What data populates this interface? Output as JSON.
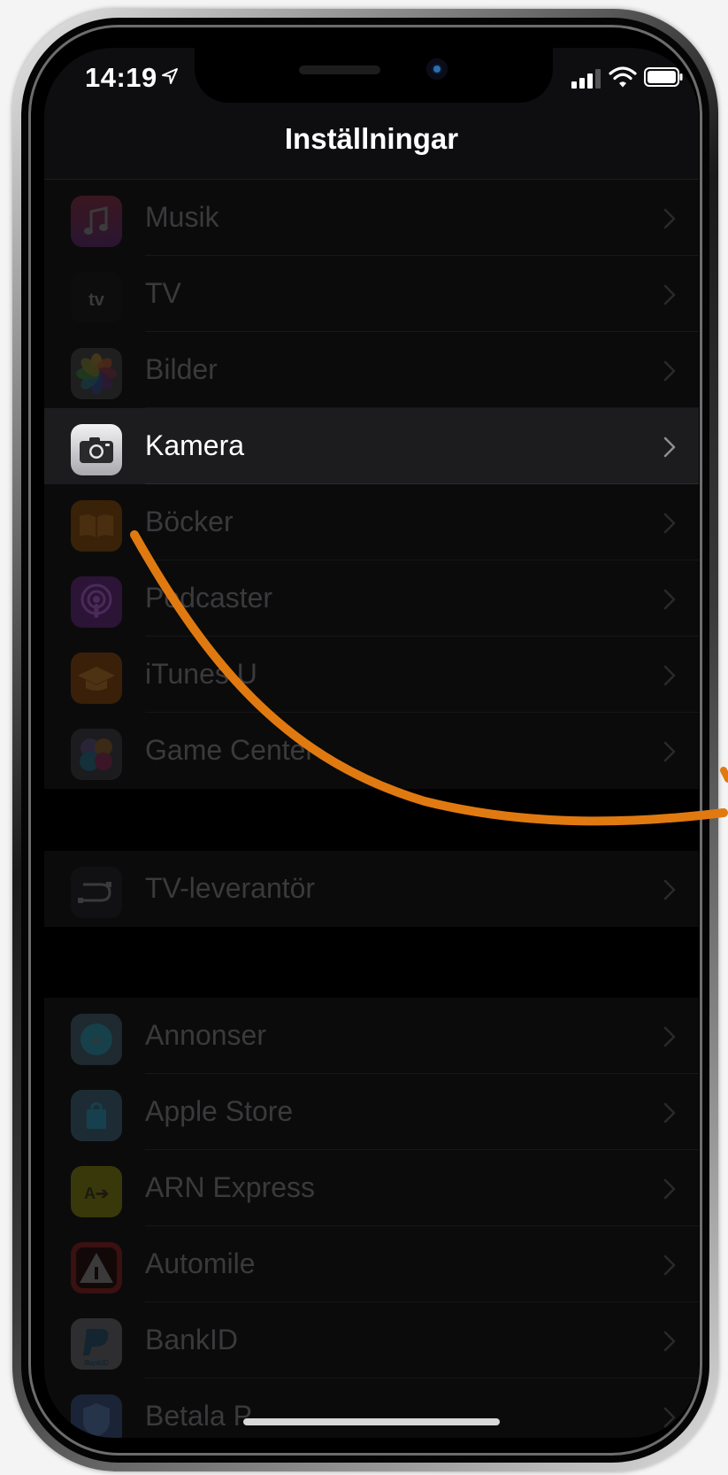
{
  "status_bar": {
    "time": "14:19"
  },
  "nav": {
    "title": "Inställningar"
  },
  "groups": [
    {
      "rows": [
        {
          "label": "Musik"
        },
        {
          "label": "TV",
          "icon_text": "tv"
        },
        {
          "label": "Bilder"
        },
        {
          "label": "Kamera",
          "highlighted": true
        },
        {
          "label": "Böcker"
        },
        {
          "label": "Podcaster"
        },
        {
          "label": "iTunes U"
        },
        {
          "label": "Game Center"
        }
      ]
    },
    {
      "rows": [
        {
          "label": "TV-leverantör"
        }
      ]
    },
    {
      "rows": [
        {
          "label": "Annonser"
        },
        {
          "label": "Apple Store"
        },
        {
          "label": "ARN Express",
          "icon_text": "A➔"
        },
        {
          "label": "Automile"
        },
        {
          "label": "BankID",
          "icon_text": "BankID"
        },
        {
          "label": "Betala P"
        }
      ]
    }
  ],
  "colors": {
    "annotation_stroke": "#e07a10",
    "dim_label": "#3a3a3c",
    "highlight_row": "#1c1c1e"
  }
}
